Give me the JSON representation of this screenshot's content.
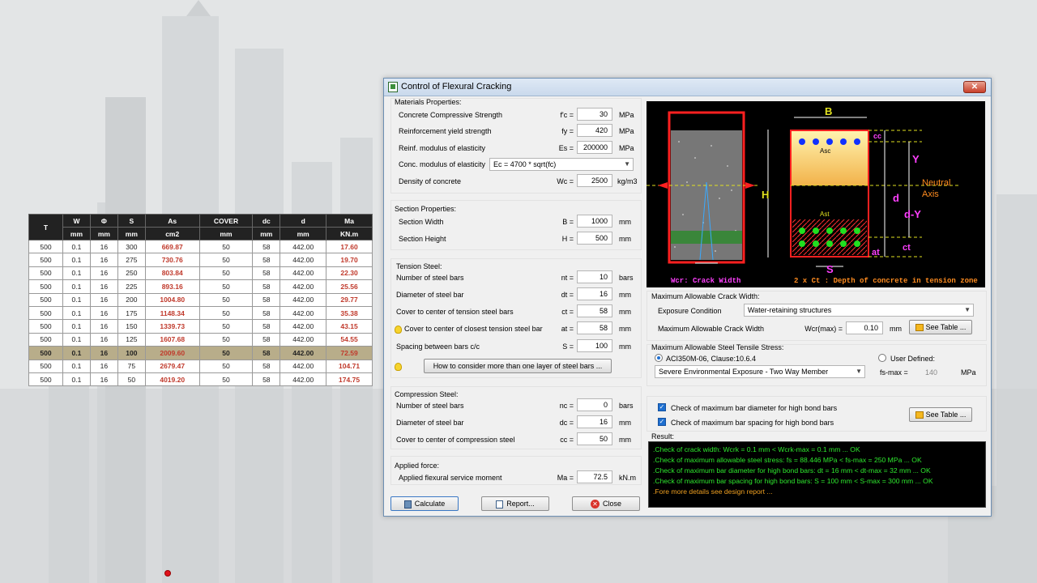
{
  "table": {
    "headers": [
      "T",
      "W",
      "Φ",
      "S",
      "As",
      "COVER",
      "dc",
      "d",
      "Ma"
    ],
    "units": [
      "mm",
      "mm",
      "mm",
      "cm2",
      "mm",
      "mm",
      "mm",
      "KN.m"
    ],
    "rows": [
      [
        "500",
        "0.1",
        "16",
        "300",
        "669.87",
        "50",
        "58",
        "442.00",
        "17.60"
      ],
      [
        "500",
        "0.1",
        "16",
        "275",
        "730.76",
        "50",
        "58",
        "442.00",
        "19.70"
      ],
      [
        "500",
        "0.1",
        "16",
        "250",
        "803.84",
        "50",
        "58",
        "442.00",
        "22.30"
      ],
      [
        "500",
        "0.1",
        "16",
        "225",
        "893.16",
        "50",
        "58",
        "442.00",
        "25.56"
      ],
      [
        "500",
        "0.1",
        "16",
        "200",
        "1004.80",
        "50",
        "58",
        "442.00",
        "29.77"
      ],
      [
        "500",
        "0.1",
        "16",
        "175",
        "1148.34",
        "50",
        "58",
        "442.00",
        "35.38"
      ],
      [
        "500",
        "0.1",
        "16",
        "150",
        "1339.73",
        "50",
        "58",
        "442.00",
        "43.15"
      ],
      [
        "500",
        "0.1",
        "16",
        "125",
        "1607.68",
        "50",
        "58",
        "442.00",
        "54.55"
      ],
      [
        "500",
        "0.1",
        "16",
        "100",
        "2009.60",
        "50",
        "58",
        "442.00",
        "72.59"
      ],
      [
        "500",
        "0.1",
        "16",
        "75",
        "2679.47",
        "50",
        "58",
        "442.00",
        "104.71"
      ],
      [
        "500",
        "0.1",
        "16",
        "50",
        "4019.20",
        "50",
        "58",
        "442.00",
        "174.75"
      ]
    ],
    "highlighted_row": 8
  },
  "window": {
    "title": "Control of Flexural Cracking",
    "close_glyph": "✕"
  },
  "materials": {
    "title": "Materials Properties:",
    "fc_label": "Concrete Compressive Strength",
    "fc_sym": "f'c =",
    "fc_val": "30",
    "fc_unit": "MPa",
    "fy_label": "Reinforcement yield strength",
    "fy_sym": "fy =",
    "fy_val": "420",
    "fy_unit": "MPa",
    "es_label": "Reinf. modulus of elasticity",
    "es_sym": "Es =",
    "es_val": "200000",
    "es_unit": "MPa",
    "ec_label": "Conc. modulus of elasticity",
    "ec_val": "Ec = 4700 * sqrt(fc)",
    "wc_label": "Density of concrete",
    "wc_sym": "Wc =",
    "wc_val": "2500",
    "wc_unit": "kg/m3"
  },
  "section": {
    "title": "Section Properties:",
    "b_label": "Section Width",
    "b_sym": "B =",
    "b_val": "1000",
    "b_unit": "mm",
    "h_label": "Section Height",
    "h_sym": "H =",
    "h_val": "500",
    "h_unit": "mm"
  },
  "tension": {
    "title": "Tension Steel:",
    "nt_label": "Number of steel bars",
    "nt_sym": "nt =",
    "nt_val": "10",
    "nt_unit": "bars",
    "dt_label": "Diameter of steel bar",
    "dt_sym": "dt =",
    "dt_val": "16",
    "dt_unit": "mm",
    "ct_label": "Cover to center of tension steel bars",
    "ct_sym": "ct =",
    "ct_val": "58",
    "ct_unit": "mm",
    "at_label": "Cover to center of closest tension steel bar",
    "at_sym": "at =",
    "at_val": "58",
    "at_unit": "mm",
    "s_label": "Spacing between bars c/c",
    "s_sym": "S =",
    "s_val": "100",
    "s_unit": "mm",
    "layers_btn": "How to consider more than one layer of steel bars ..."
  },
  "compression": {
    "title": "Compression Steel:",
    "nc_label": "Number of steel bars",
    "nc_sym": "nc =",
    "nc_val": "0",
    "nc_unit": "bars",
    "dc_label": "Diameter of steel bar",
    "dc_sym": "dc =",
    "dc_val": "16",
    "dc_unit": "mm",
    "cc_label": "Cover to center of compression steel",
    "cc_sym": "cc =",
    "cc_val": "50",
    "cc_unit": "mm"
  },
  "force": {
    "title": "Applied force:",
    "ma_label": "Applied flexural service moment",
    "ma_sym": "Ma =",
    "ma_val": "72.5",
    "ma_unit": "kN.m"
  },
  "buttons": {
    "calculate": "Calculate",
    "report": "Report...",
    "close": "Close"
  },
  "diagram": {
    "crack_width": "Wcr: Crack Width",
    "caption": "2 x Ct : Depth of concrete in tension zone",
    "B": "B",
    "H": "H",
    "Y": "Y",
    "d": "d",
    "dY": "d-Y",
    "cc": "cc",
    "ct": "ct",
    "at": "at",
    "S": "S",
    "asc": "Asc",
    "ast": "Ast",
    "neutral": "Neutral",
    "axis": "Axis"
  },
  "crack": {
    "title": "Maximum Allowable Crack Width:",
    "exposure_label": "Exposure Condition",
    "exposure_val": "Water-retaining structures",
    "wcr_label": "Maximum Allowable Crack Width",
    "wcr_sym": "Wcr(max) =",
    "wcr_val": "0.10",
    "wcr_unit": "mm",
    "see_table": "See Table ..."
  },
  "stress": {
    "title": "Maximum Allowable Steel Tensile Stress:",
    "aci_label": "ACI350M-06, Clause:10.6.4",
    "user_label": "User Defined:",
    "env_val": "Severe Environmental Exposure - Two Way Member",
    "fs_sym": "fs-max =",
    "fs_val": "140",
    "fs_unit": "MPa"
  },
  "checks": {
    "dia_label": "Check of maximum bar diameter for high bond bars",
    "spacing_label": "Check of maximum bar spacing for high bond bars",
    "see_table": "See Table ..."
  },
  "result": {
    "title": "Result:",
    "lines": [
      ".Check of crack width: Wcrk = 0.1 mm < Wcrk-max = 0.1 mm  ... OK",
      ".Check of maximum allowable steel stress: fs = 88.446 MPa < fs-max = 250 MPa  ... OK",
      ".Check of maximum bar diameter for high bond bars: dt = 16 mm < dt-max = 32 mm  ... OK",
      ".Check of maximum bar spacing for high bond bars: S = 100 mm < S-max = 300 mm  ... OK",
      ".Fore more details see design report ..."
    ]
  },
  "colors": {
    "ok_green": "#2ee82e",
    "note_orange": "#f0a020",
    "table_red": "#c0392b",
    "highlight": "#b8ad8a"
  }
}
